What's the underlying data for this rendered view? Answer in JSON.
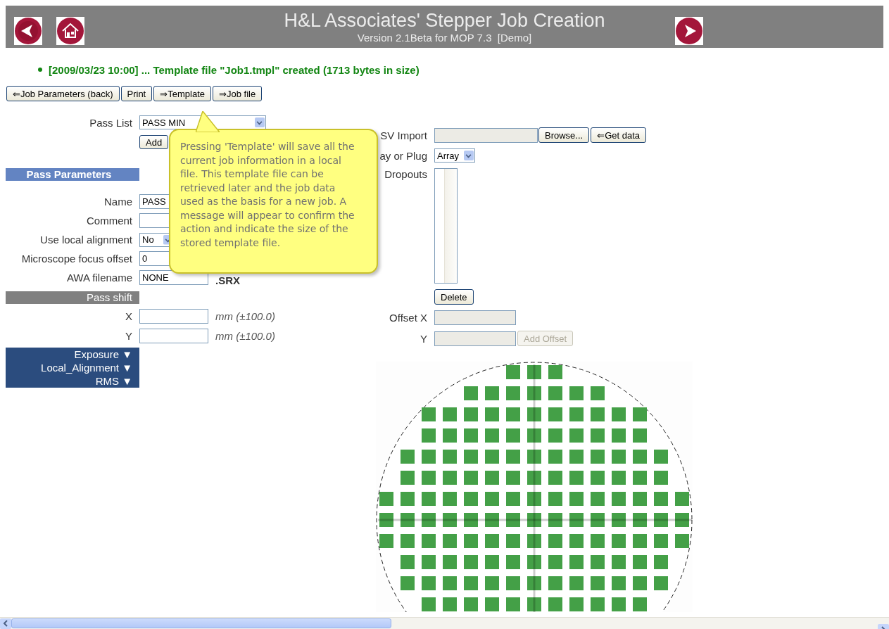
{
  "header": {
    "title": "H&L Associates' Stepper Job Creation",
    "subtitle": "Version 2.1Beta for MOP 7.3  [Demo]"
  },
  "message": "[2009/03/23 10:00] ... Template file \"Job1.tmpl\" created (1713 bytes in size)",
  "toolbar": [
    "⇐Job Parameters (back)",
    "Print",
    "⇒Template",
    "⇒Job file"
  ],
  "pass_list": {
    "label": "Pass List",
    "value": "PASS MIN",
    "add_button": "Add"
  },
  "pass_parameters": {
    "title": "Pass Parameters",
    "fields": [
      {
        "label": "Name",
        "kind": "text",
        "value": "PASS"
      },
      {
        "label": "Comment",
        "kind": "text"
      },
      {
        "label": "Use local alignment",
        "kind": "select",
        "value": "No"
      },
      {
        "label": "Microscope focus offset",
        "kind": "text",
        "value": "0"
      },
      {
        "label": "AWA filename",
        "kind": "text",
        "value": "NONE",
        "suffix": ".SRX"
      }
    ]
  },
  "pass_shift": {
    "title": "Pass shift",
    "fields": [
      {
        "label": "X",
        "unit": "mm (±100.0)"
      },
      {
        "label": "Y",
        "unit": "mm (±100.0)"
      }
    ]
  },
  "sections": [
    "Exposure ▼",
    "Local_Alignment ▼",
    "RMS ▼"
  ],
  "csv_import": {
    "label": "SV Import",
    "browse_button": "Browse...",
    "get_button": "⇐Get data"
  },
  "array_or_plug": {
    "label": "ay or Plug",
    "value": "Array"
  },
  "dropouts": {
    "label": "Dropouts",
    "delete_button": "Delete"
  },
  "offset": {
    "x_label": "Offset X",
    "y_label": "Y",
    "add_button": "Add Offset",
    "disabled": true
  },
  "tooltip": {
    "text": "Pressing 'Template' will save all the current job information in a local file. This template file can be retrieved later and the job data used as the basis for a new job. A message will appear  to confirm the action and indicate the size of the stored template file."
  }
}
